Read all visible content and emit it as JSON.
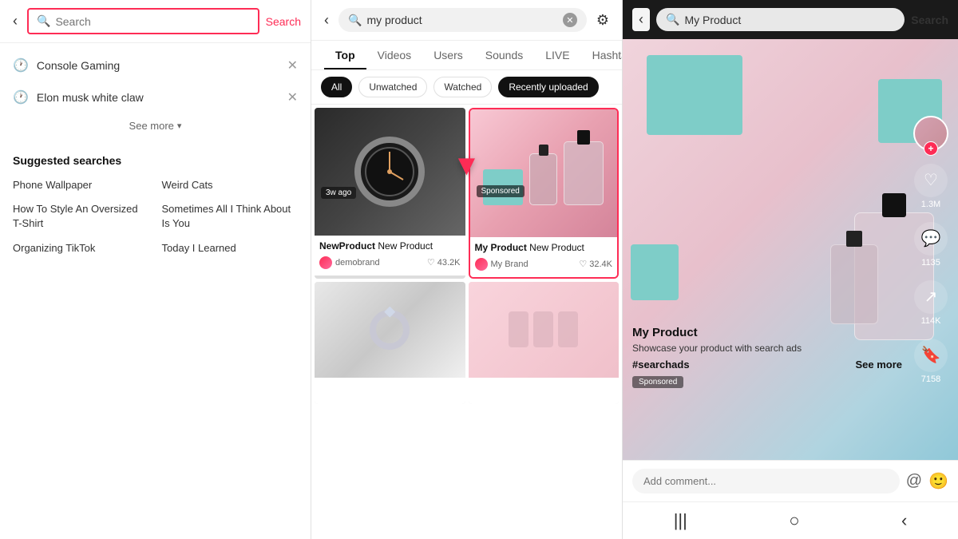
{
  "panel1": {
    "back_label": "‹",
    "search_placeholder": "Search",
    "search_btn": "Search",
    "recent_items": [
      {
        "text": "Console Gaming"
      },
      {
        "text": "Elon musk white claw"
      }
    ],
    "see_more": "See more",
    "suggested_title": "Suggested searches",
    "suggestions": [
      {
        "text": "Phone Wallpaper"
      },
      {
        "text": "Weird Cats"
      },
      {
        "text": "How To Style An Oversized T-Shirt"
      },
      {
        "text": "Sometimes All I Think About Is You"
      },
      {
        "text": "Organizing TikTok"
      },
      {
        "text": "Today I Learned"
      }
    ]
  },
  "panel2": {
    "back_label": "‹",
    "search_value": "my product",
    "filter_icon": "⚙",
    "tabs": [
      {
        "label": "Top",
        "active": true
      },
      {
        "label": "Videos"
      },
      {
        "label": "Users"
      },
      {
        "label": "Sounds"
      },
      {
        "label": "LIVE"
      },
      {
        "label": "Hashtags"
      }
    ],
    "filters": [
      {
        "label": "All",
        "active": true
      },
      {
        "label": "Unwatched"
      },
      {
        "label": "Watched"
      },
      {
        "label": "Recently uploaded",
        "highlight": true
      }
    ],
    "cards": [
      {
        "title_bold": "NewProduct",
        "title_rest": " New Product",
        "user": "demobrand",
        "likes": "43.2K",
        "time": "3w ago",
        "type": "watch"
      },
      {
        "title_bold": "My Product",
        "title_rest": " New Product",
        "user": "My Brand",
        "likes": "32.4K",
        "sponsored": true,
        "type": "perfume"
      },
      {
        "type": "ring"
      },
      {
        "type": "flowers"
      }
    ]
  },
  "panel3": {
    "back_label": "‹",
    "search_value": "My Product",
    "search_btn": "Search",
    "video_title": "My Product",
    "video_desc": "Showcase your product with search ads",
    "hashtag": "#searchads",
    "see_more": "See more",
    "sponsored_label": "Sponsored",
    "actions": {
      "likes": "1.3M",
      "comments": "1135",
      "shares": "114K",
      "bookmarks": "7158"
    },
    "comment_placeholder": "Add comment...",
    "nav_items": [
      "|||",
      "○",
      "‹"
    ]
  }
}
